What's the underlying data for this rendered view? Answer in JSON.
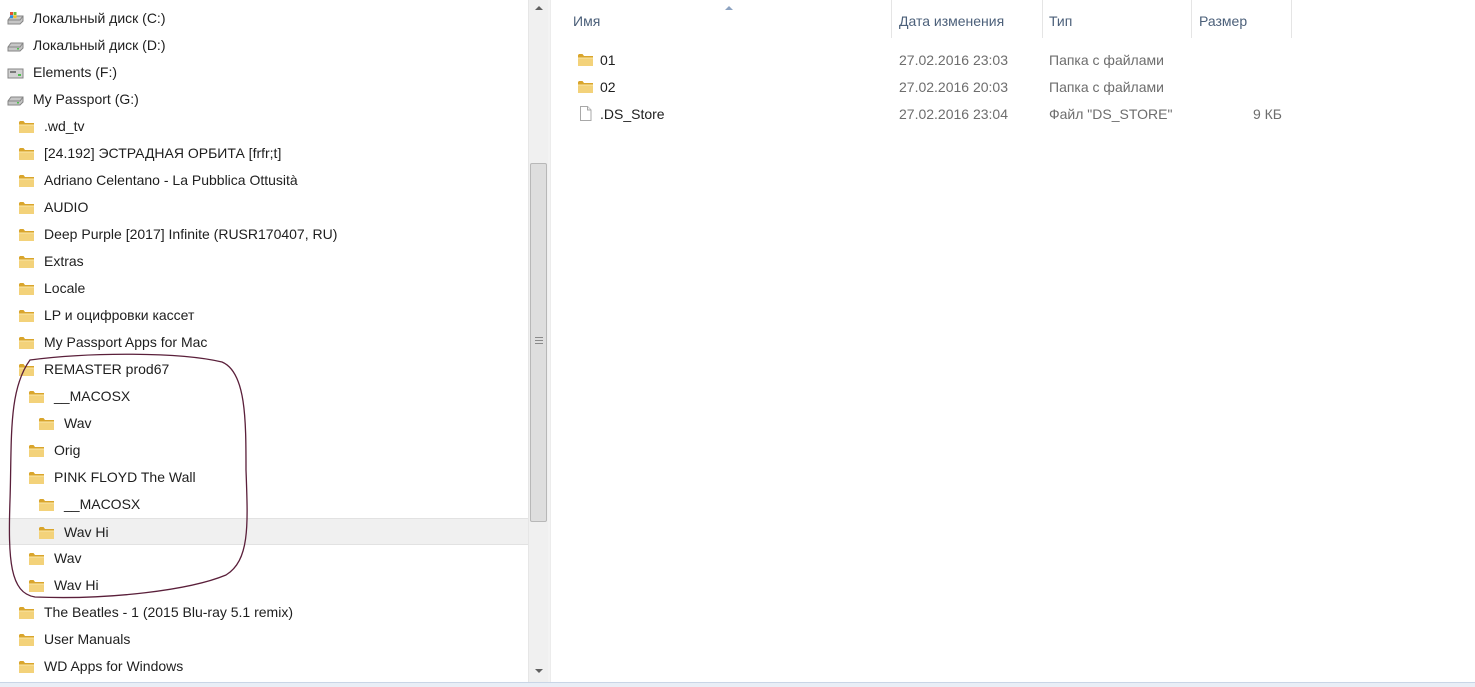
{
  "navigation_tree": {
    "items": [
      {
        "label": "Локальный диск (C:)",
        "icon": "windows-drive-icon",
        "level": 0
      },
      {
        "label": "Локальный диск (D:)",
        "icon": "hard-drive-icon",
        "level": 0
      },
      {
        "label": "Elements (F:)",
        "icon": "usb-drive-icon",
        "level": 0
      },
      {
        "label": "My Passport (G:)",
        "icon": "hard-drive-icon",
        "level": 0
      },
      {
        "label": ".wd_tv",
        "icon": "folder-icon",
        "level": 1
      },
      {
        "label": "[24.192] ЭСТРАДНАЯ ОРБИТА  [frfr;t]",
        "icon": "folder-icon",
        "level": 1
      },
      {
        "label": "Adriano Celentano - La Pubblica Ottusità",
        "icon": "folder-icon",
        "level": 1
      },
      {
        "label": "AUDIO",
        "icon": "folder-icon",
        "level": 1
      },
      {
        "label": "Deep Purple [2017] Infinite (RUSR170407, RU)",
        "icon": "folder-icon",
        "level": 1
      },
      {
        "label": "Extras",
        "icon": "folder-icon",
        "level": 1
      },
      {
        "label": "Locale",
        "icon": "folder-icon",
        "level": 1
      },
      {
        "label": "LP и оцифровки кассет",
        "icon": "folder-icon",
        "level": 1
      },
      {
        "label": "My Passport Apps for Mac",
        "icon": "folder-icon",
        "level": 1
      },
      {
        "label": "REMASTER prod67",
        "icon": "folder-icon",
        "level": 1
      },
      {
        "label": "__MACOSX",
        "icon": "folder-icon",
        "level": 2
      },
      {
        "label": "Wav",
        "icon": "folder-icon",
        "level": 3
      },
      {
        "label": "Orig",
        "icon": "folder-icon",
        "level": 2
      },
      {
        "label": "PINK FLOYD The Wall",
        "icon": "folder-icon",
        "level": 2
      },
      {
        "label": "__MACOSX",
        "icon": "folder-icon",
        "level": 3
      },
      {
        "label": "Wav Hi",
        "icon": "folder-icon",
        "level": 3,
        "selected": true
      },
      {
        "label": "Wav",
        "icon": "folder-icon",
        "level": 2
      },
      {
        "label": "Wav Hi",
        "icon": "folder-icon",
        "level": 2
      },
      {
        "label": "The Beatles - 1 (2015 Blu-ray 5.1 remix)",
        "icon": "folder-icon",
        "level": 1
      },
      {
        "label": "User Manuals",
        "icon": "folder-icon",
        "level": 1
      },
      {
        "label": "WD Apps for Windows",
        "icon": "folder-icon",
        "level": 1
      }
    ]
  },
  "file_list": {
    "columns": {
      "name": "Имя",
      "date": "Дата изменения",
      "type": "Тип",
      "size": "Размер"
    },
    "sort_icon": "sort-ascending-icon",
    "rows": [
      {
        "name": "01",
        "date": "27.02.2016 23:03",
        "type": "Папка с файлами",
        "size": "",
        "icon": "folder-icon"
      },
      {
        "name": "02",
        "date": "27.02.2016 20:03",
        "type": "Папка с файлами",
        "size": "",
        "icon": "folder-icon"
      },
      {
        "name": ".DS_Store",
        "date": "27.02.2016 23:04",
        "type": "Файл \"DS_STORE\"",
        "size": "9 КБ",
        "icon": "file-icon"
      }
    ]
  },
  "colors": {
    "folder": "#e8c04f",
    "header_text": "#4c607a",
    "selected_row": "#f0f0f0",
    "annotation_stroke": "#5a1f3a"
  }
}
